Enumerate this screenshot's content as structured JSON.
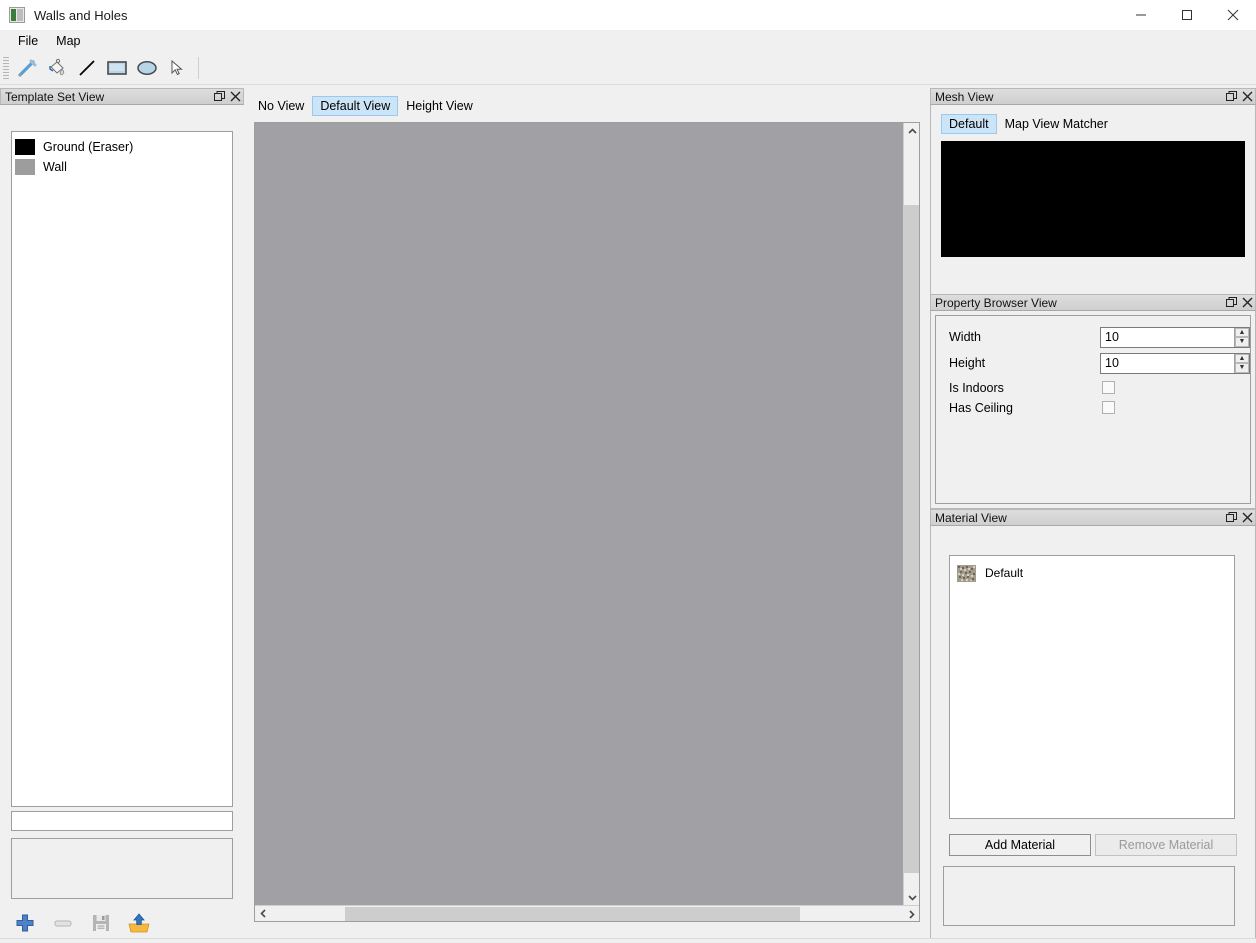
{
  "window": {
    "title": "Walls and Holes",
    "icon": "app-icon",
    "buttons": {
      "minimize": "minimize-icon",
      "maximize": "maximize-icon",
      "close": "close-icon"
    }
  },
  "menubar": {
    "items": [
      {
        "label": "File"
      },
      {
        "label": "Map"
      }
    ]
  },
  "toolbar": {
    "tools": [
      {
        "name": "brush-tool",
        "icon": "paintbrush-icon"
      },
      {
        "name": "fill-tool",
        "icon": "paint-bucket-icon"
      },
      {
        "name": "line-tool",
        "icon": "line-icon"
      },
      {
        "name": "rectangle-tool",
        "icon": "rectangle-icon"
      },
      {
        "name": "ellipse-tool",
        "icon": "ellipse-icon"
      },
      {
        "name": "select-tool",
        "icon": "cursor-arrow-icon"
      }
    ]
  },
  "template_set_view": {
    "title": "Template Set View",
    "float_icon": "float-icon",
    "close_icon": "close-icon",
    "items": [
      {
        "label": "Ground (Eraser)",
        "color": "#000000"
      },
      {
        "label": "Wall",
        "color": "#9d9d9d"
      }
    ],
    "name_field": {
      "value": "",
      "placeholder": ""
    },
    "tools": [
      {
        "name": "add-template-button",
        "icon": "plus-icon"
      },
      {
        "name": "remove-template-button",
        "icon": "minus-icon"
      },
      {
        "name": "save-template-button",
        "icon": "floppy-disk-icon"
      },
      {
        "name": "load-template-button",
        "icon": "open-tray-icon"
      }
    ]
  },
  "center": {
    "tabs": [
      {
        "label": "No View",
        "active": false
      },
      {
        "label": "Default View",
        "active": true
      },
      {
        "label": "Height View",
        "active": false
      }
    ],
    "canvas": {
      "name": "map-canvas",
      "color": "#a0a0a5"
    },
    "scrollbars": {
      "vertical": {
        "up": "chevron-up-icon",
        "down": "chevron-down-icon"
      },
      "horizontal": {
        "left": "chevron-left-icon",
        "right": "chevron-right-icon"
      }
    }
  },
  "mesh_view": {
    "title": "Mesh View",
    "float_icon": "float-icon",
    "close_icon": "close-icon",
    "tabs": [
      {
        "label": "Default",
        "active": true
      },
      {
        "label": "Map View Matcher",
        "active": false
      }
    ],
    "viewport_color": "#000000"
  },
  "property_browser_view": {
    "title": "Property Browser View",
    "float_icon": "float-icon",
    "close_icon": "close-icon",
    "rows": [
      {
        "label": "Width",
        "type": "spinbox",
        "value": "10"
      },
      {
        "label": "Height",
        "type": "spinbox",
        "value": "10"
      },
      {
        "label": "Is Indoors",
        "type": "checkbox",
        "checked": false
      },
      {
        "label": "Has Ceiling",
        "type": "checkbox",
        "checked": false
      }
    ]
  },
  "material_view": {
    "title": "Material View",
    "float_icon": "float-icon",
    "close_icon": "close-icon",
    "materials": [
      {
        "label": "Default",
        "thumb": "noise-texture-thumb"
      }
    ],
    "add_button": {
      "label": "Add Material",
      "enabled": true
    },
    "remove_button": {
      "label": "Remove Material",
      "enabled": false
    }
  }
}
